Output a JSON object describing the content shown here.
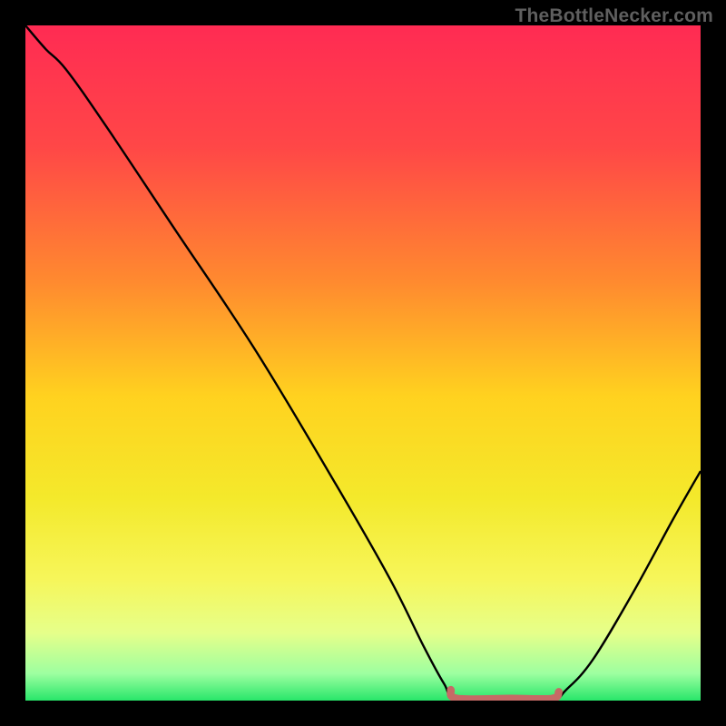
{
  "watermark": "TheBottleNecker.com",
  "chart_data": {
    "type": "line",
    "title": "",
    "xlabel": "",
    "ylabel": "",
    "xlim": [
      0,
      100
    ],
    "ylim": [
      0,
      100
    ],
    "gradient_stops": [
      {
        "offset": 0.0,
        "color": "#ff2b53"
      },
      {
        "offset": 0.18,
        "color": "#ff4747"
      },
      {
        "offset": 0.38,
        "color": "#ff8a2f"
      },
      {
        "offset": 0.55,
        "color": "#ffd21f"
      },
      {
        "offset": 0.7,
        "color": "#f4e92b"
      },
      {
        "offset": 0.82,
        "color": "#f6f65a"
      },
      {
        "offset": 0.9,
        "color": "#e6ff8a"
      },
      {
        "offset": 0.96,
        "color": "#9dffa0"
      },
      {
        "offset": 1.0,
        "color": "#28e66a"
      }
    ],
    "series": [
      {
        "name": "bottleneck-curve",
        "color": "#000000",
        "width": 2.4,
        "points": [
          {
            "x": 0.0,
            "y": 100.0
          },
          {
            "x": 3.0,
            "y": 96.5
          },
          {
            "x": 6.0,
            "y": 93.5
          },
          {
            "x": 12.0,
            "y": 85.0
          },
          {
            "x": 22.0,
            "y": 70.0
          },
          {
            "x": 34.0,
            "y": 52.0
          },
          {
            "x": 46.0,
            "y": 32.0
          },
          {
            "x": 54.0,
            "y": 18.0
          },
          {
            "x": 59.0,
            "y": 8.0
          },
          {
            "x": 62.0,
            "y": 2.5
          },
          {
            "x": 64.0,
            "y": 0.0
          },
          {
            "x": 72.0,
            "y": 0.0
          },
          {
            "x": 78.0,
            "y": 0.0
          },
          {
            "x": 80.0,
            "y": 1.5
          },
          {
            "x": 84.0,
            "y": 6.0
          },
          {
            "x": 90.0,
            "y": 16.0
          },
          {
            "x": 96.0,
            "y": 27.0
          },
          {
            "x": 100.0,
            "y": 34.0
          }
        ]
      },
      {
        "name": "optimal-band",
        "color": "#c66a66",
        "width": 8.5,
        "cap": "round",
        "points": [
          {
            "x": 63.0,
            "y": 1.6
          },
          {
            "x": 64.0,
            "y": 0.3
          },
          {
            "x": 72.0,
            "y": 0.3
          },
          {
            "x": 78.0,
            "y": 0.3
          },
          {
            "x": 79.0,
            "y": 1.3
          }
        ]
      }
    ]
  }
}
